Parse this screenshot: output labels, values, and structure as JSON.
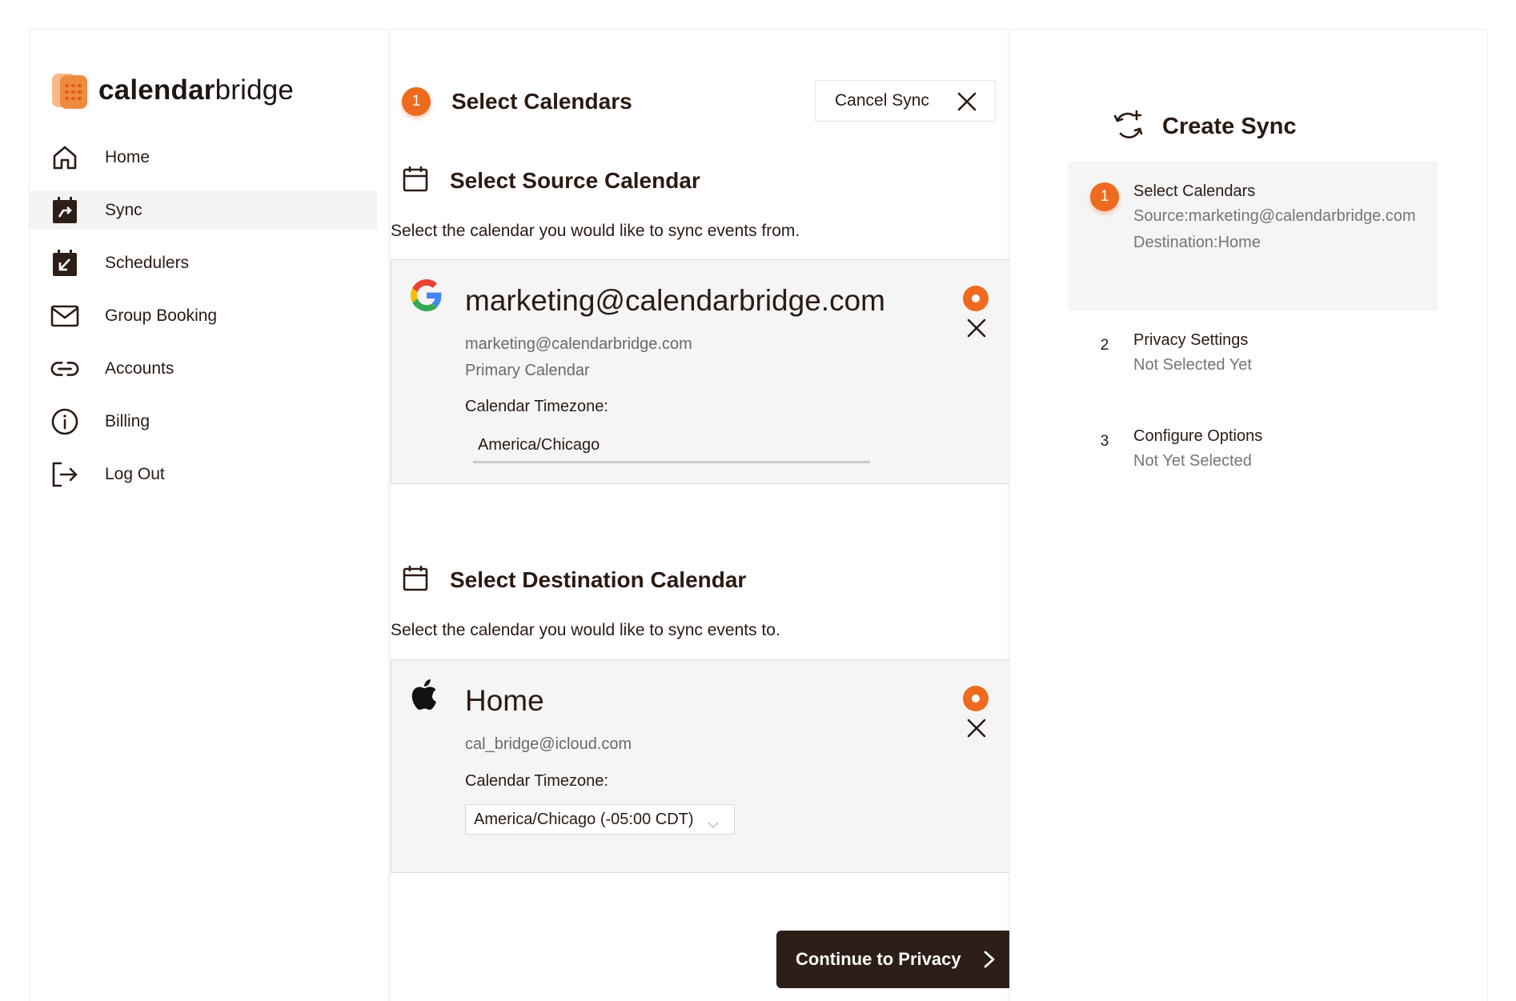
{
  "brand": {
    "name_bold": "calendar",
    "name_light": "bridge",
    "accent": "#ee6a1f",
    "dark": "#2d1e18"
  },
  "sidebar": {
    "items": [
      {
        "label": "Home",
        "icon": "home-icon",
        "active": false
      },
      {
        "label": "Sync",
        "icon": "sync-calendar-icon",
        "active": true
      },
      {
        "label": "Schedulers",
        "icon": "scheduler-icon",
        "active": false
      },
      {
        "label": "Group Booking",
        "icon": "mail-icon",
        "active": false
      },
      {
        "label": "Accounts",
        "icon": "link-icon",
        "active": false
      },
      {
        "label": "Billing",
        "icon": "info-icon",
        "active": false
      },
      {
        "label": "Log Out",
        "icon": "logout-icon",
        "active": false
      }
    ]
  },
  "main": {
    "step_number": "1",
    "step_title": "Select Calendars",
    "cancel_label": "Cancel Sync",
    "source": {
      "title": "Select Source Calendar",
      "description": "Select the calendar you would like to sync events from.",
      "calendar": {
        "provider": "google-icon",
        "name": "marketing@calendarbridge.com",
        "email": "marketing@calendarbridge.com",
        "type": "Primary Calendar",
        "tz_label": "Calendar Timezone:",
        "tz_value": "America/Chicago"
      }
    },
    "destination": {
      "title": "Select Destination Calendar",
      "description": "Select the calendar you would like to sync events to.",
      "calendar": {
        "provider": "apple-icon",
        "name": "Home",
        "email": "cal_bridge@icloud.com",
        "tz_label": "Calendar Timezone:",
        "tz_value": "America/Chicago (-05:00 CDT)"
      }
    },
    "continue_label": "Continue to Privacy"
  },
  "right": {
    "title": "Create Sync",
    "steps": [
      {
        "number": "1",
        "label": "Select Calendars",
        "detail_1": "Source:marketing@calendarbridge.com",
        "detail_2": "Destination:Home",
        "active": true
      },
      {
        "number": "2",
        "label": "Privacy Settings",
        "detail_1": "Not Selected Yet",
        "active": false
      },
      {
        "number": "3",
        "label": "Configure Options",
        "detail_1": "Not Yet Selected",
        "active": false
      }
    ]
  }
}
